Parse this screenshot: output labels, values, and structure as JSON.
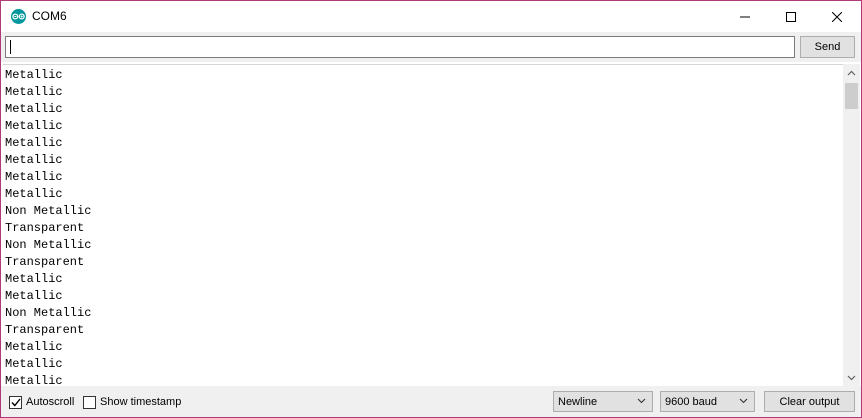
{
  "window": {
    "title": "COM6"
  },
  "input": {
    "value": "",
    "send_label": "Send"
  },
  "output": {
    "lines": [
      "Metallic",
      "Metallic",
      "Metallic",
      "Metallic",
      "Metallic",
      "Metallic",
      "Metallic",
      "Metallic",
      "Non Metallic",
      "Transparent",
      "Non Metallic",
      "Transparent",
      "Metallic",
      "Metallic",
      "Non Metallic",
      "Transparent",
      "Metallic",
      "Metallic",
      "Metallic"
    ]
  },
  "bottom": {
    "autoscroll_label": "Autoscroll",
    "autoscroll_checked": true,
    "timestamp_label": "Show timestamp",
    "timestamp_checked": false,
    "line_ending": "Newline",
    "baud_rate": "9600 baud",
    "clear_label": "Clear output"
  },
  "colors": {
    "window_border": "#b03a78",
    "app_icon": "#00979d"
  },
  "icons": {
    "app": "arduino-logo-icon",
    "minimize": "minimize-icon",
    "maximize": "maximize-icon",
    "close": "close-icon"
  }
}
